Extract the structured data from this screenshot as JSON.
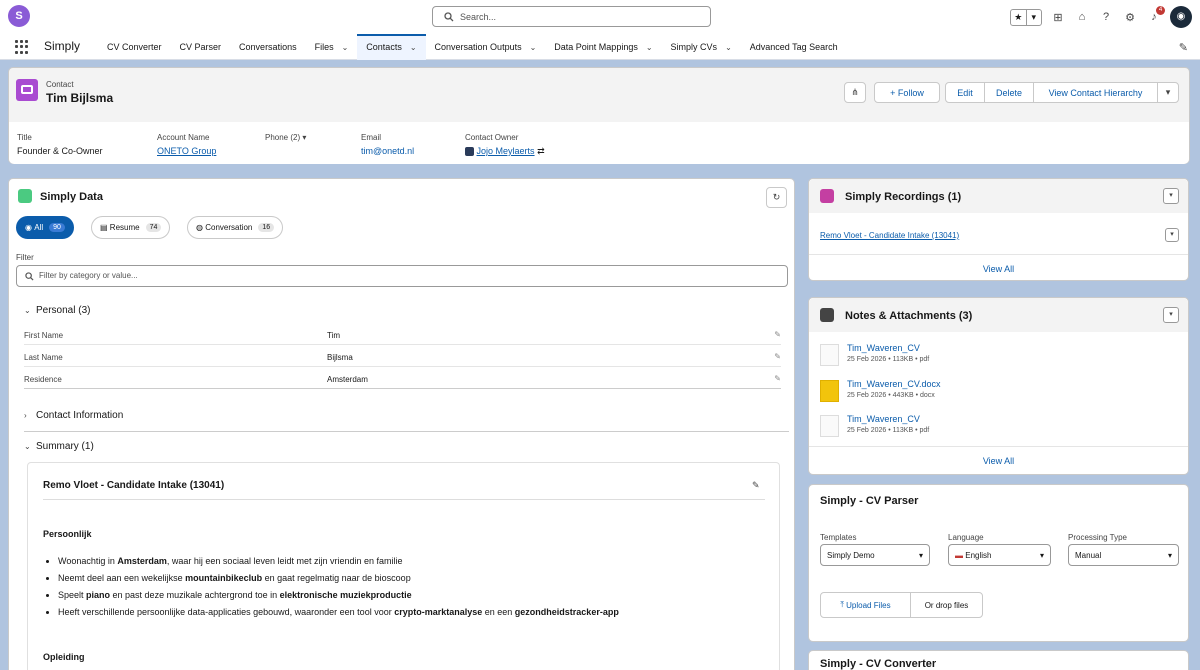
{
  "header": {
    "logo_letter": "S",
    "search_placeholder": "Search...",
    "notification_count": "4"
  },
  "nav": {
    "app_name": "Simply",
    "items": [
      {
        "label": "CV Converter",
        "chevron": false
      },
      {
        "label": "CV Parser",
        "chevron": false
      },
      {
        "label": "Conversations",
        "chevron": false
      },
      {
        "label": "Files",
        "chevron": true
      },
      {
        "label": "Contacts",
        "chevron": true,
        "active": true
      },
      {
        "label": "Conversation Outputs",
        "chevron": true
      },
      {
        "label": "Data Point Mappings",
        "chevron": true
      },
      {
        "label": "Simply CVs",
        "chevron": true
      },
      {
        "label": "Advanced Tag Search",
        "chevron": false
      }
    ]
  },
  "record": {
    "type": "Contact",
    "name": "Tim Bijlsma",
    "actions": {
      "follow": "+ Follow",
      "edit": "Edit",
      "delete": "Delete",
      "hierarchy": "View Contact Hierarchy"
    },
    "fields": {
      "title_label": "Title",
      "title_value": "Founder & Co-Owner",
      "account_label": "Account Name",
      "account_value": "ONETO Group",
      "phone_label": "Phone (2)",
      "email_label": "Email",
      "email_value": "tim@onetd.nl",
      "owner_label": "Contact Owner",
      "owner_value": "Jojo Meylaerts"
    }
  },
  "simply_data": {
    "title": "Simply Data",
    "tabs": {
      "all": {
        "label": "All",
        "count": "90"
      },
      "resume": {
        "label": "Resume",
        "count": "74"
      },
      "conversation": {
        "label": "Conversation",
        "count": "16"
      }
    },
    "filter_label": "Filter",
    "filter_placeholder": "Filter by category or value...",
    "personal_section": "Personal (3)",
    "personal_rows": {
      "first_name_label": "First Name",
      "first_name_value": "Tim",
      "last_name_label": "Last Name",
      "last_name_value": "Bijlsma",
      "residence_label": "Residence",
      "residence_value": "Amsterdam"
    },
    "contact_info_section": "Contact Information",
    "summary_section": "Summary (1)",
    "summary": {
      "title": "Remo Vloet - Candidate Intake (13041)",
      "heading": "Persoonlijk",
      "b1_a": "Woonachtig in ",
      "b1_b": "Amsterdam",
      "b1_c": ", waar hij een sociaal leven leidt met zijn vriendin en familie",
      "b2_a": "Neemt deel aan een wekelijkse ",
      "b2_b": "mountainbikeclub",
      "b2_c": " en gaat regelmatig naar de bioscoop",
      "b3_a": "Speelt ",
      "b3_b": "piano",
      "b3_c": " en past deze muzikale achtergrond toe in ",
      "b3_d": "elektronische muziekproductie",
      "b4_a": "Heeft verschillende persoonlijke data-applicaties gebouwd, waaronder een tool voor ",
      "b4_b": "crypto-marktanalyse",
      "b4_c": " en een ",
      "b4_d": "gezondheidstracker-app",
      "heading2": "Opleiding"
    }
  },
  "recordings": {
    "title": "Simply Recordings (1)",
    "item": "Remo Vloet - Candidate Intake (13041)",
    "view_all": "View All"
  },
  "notes": {
    "title": "Notes & Attachments (3)",
    "files": [
      {
        "name": "Tim_Waveren_CV",
        "meta": "25 Feb 2026 • 113KB • pdf"
      },
      {
        "name": "Tim_Waveren_CV.docx",
        "meta": "25 Feb 2026 • 443KB • docx"
      },
      {
        "name": "Tim_Waveren_CV",
        "meta": "25 Feb 2026 • 113KB • pdf"
      }
    ],
    "view_all": "View All"
  },
  "cv_parser": {
    "title": "Simply - CV Parser",
    "templates_label": "Templates",
    "templates_value": "Simply Demo",
    "language_label": "Language",
    "language_value": "English",
    "processing_label": "Processing Type",
    "processing_value": "Manual",
    "upload_label": "Upload Files",
    "drop_label": "Or drop files"
  },
  "cv_converter": {
    "title": "Simply - CV Converter"
  }
}
